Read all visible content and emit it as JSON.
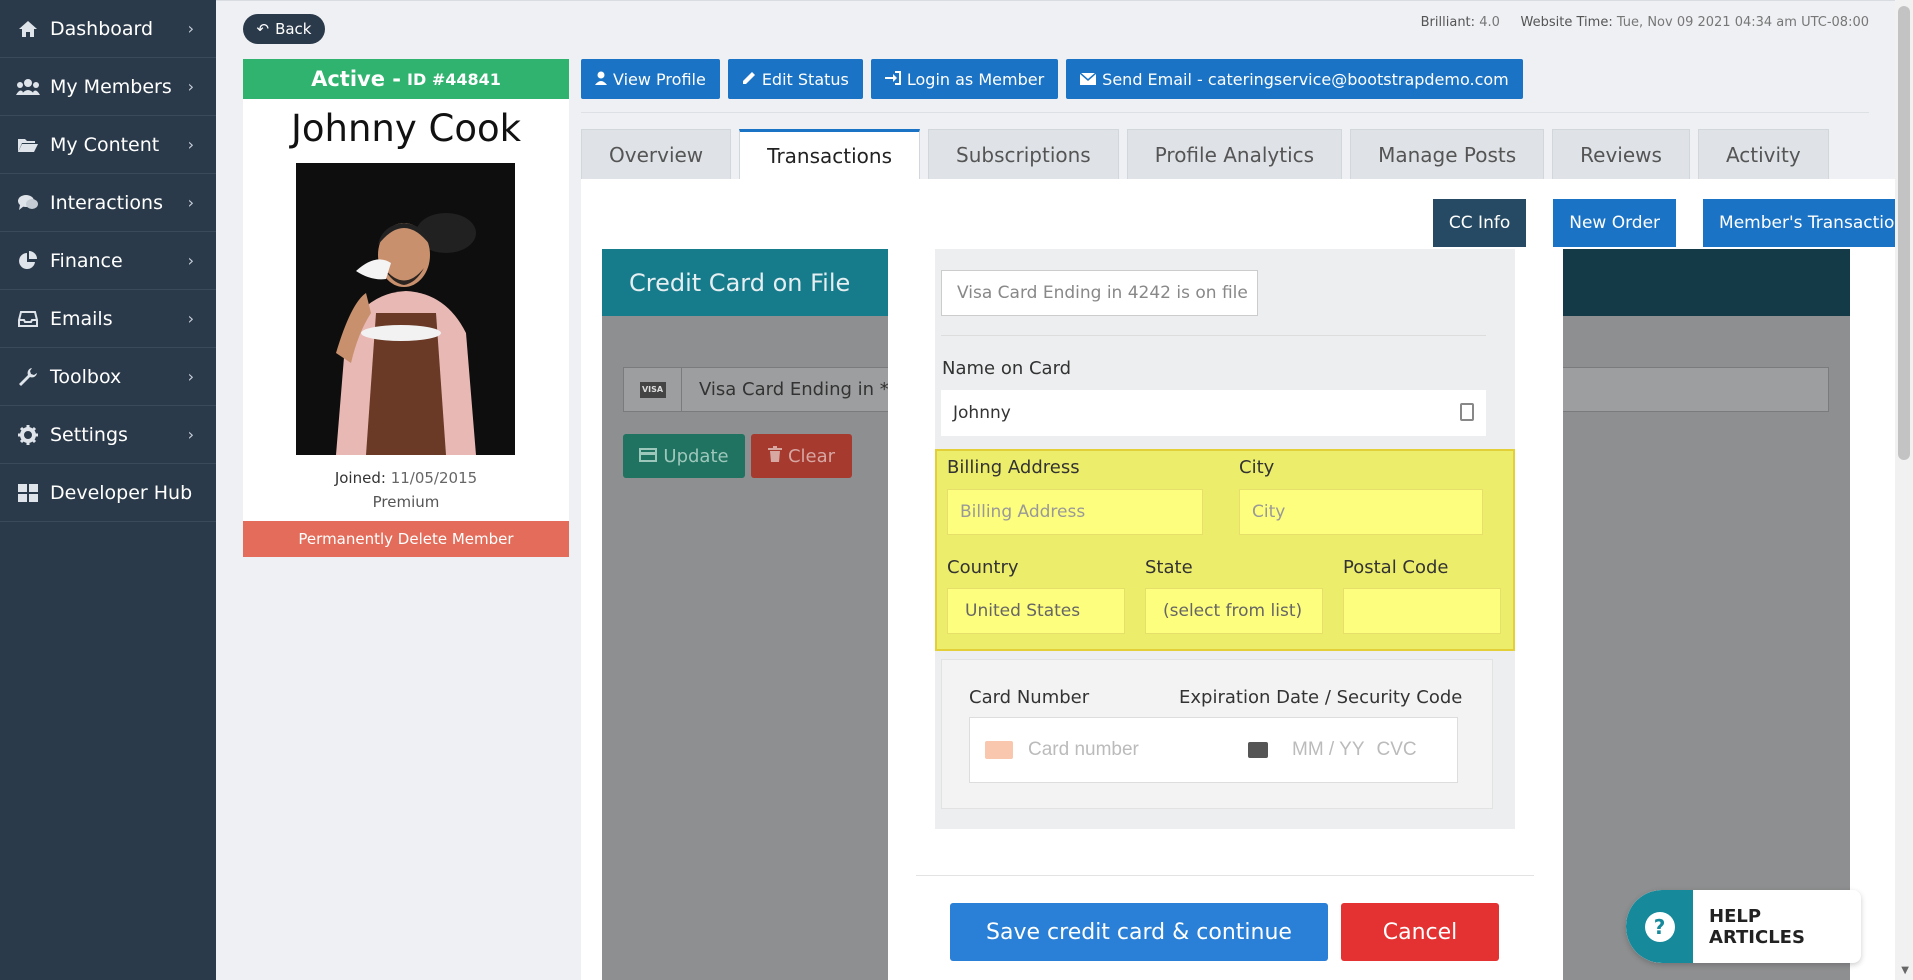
{
  "sidebar": {
    "items": [
      {
        "label": "Dashboard",
        "icon": "home-icon"
      },
      {
        "label": "My Members",
        "icon": "users-icon"
      },
      {
        "label": "My Content",
        "icon": "folder-icon"
      },
      {
        "label": "Interactions",
        "icon": "comments-icon"
      },
      {
        "label": "Finance",
        "icon": "pie-chart-icon"
      },
      {
        "label": "Emails",
        "icon": "inbox-icon"
      },
      {
        "label": "Toolbox",
        "icon": "wrench-icon"
      },
      {
        "label": "Settings",
        "icon": "gear-icon"
      },
      {
        "label": "Developer Hub",
        "icon": "grid-icon"
      }
    ]
  },
  "header": {
    "back_label": "Back",
    "brand_label": "Brilliant:",
    "brand_version": "4.0",
    "time_label": "Website Time:",
    "time_value": "Tue, Nov 09 2021 04:34 am UTC-08:00"
  },
  "profile": {
    "status": "Active -",
    "id": "ID #44841",
    "name": "Johnny Cook",
    "joined_label": "Joined:",
    "joined_date": "11/05/2015",
    "plan": "Premium",
    "delete_label": "Permanently Delete Member"
  },
  "actions": {
    "view_profile": "View Profile",
    "edit_status": "Edit Status",
    "login_as_member": "Login as Member",
    "send_email": "Send Email - cateringservice@bootstrapdemo.com"
  },
  "tabs": [
    "Overview",
    "Transactions",
    "Subscriptions",
    "Profile Analytics",
    "Manage Posts",
    "Reviews",
    "Activity"
  ],
  "active_tab": "Transactions",
  "sub_buttons": {
    "cc_info": "CC Info",
    "new_order": "New Order",
    "members_transactions": "Member's Transactions"
  },
  "cc_card": {
    "title": "Credit Card on File",
    "visa_badge": "VISA",
    "field_text": "Visa Card Ending in ***",
    "update_label": "Update",
    "clear_label": "Clear"
  },
  "modal": {
    "card_on_file": "Visa Card Ending in 4242 is on file",
    "name_label": "Name on Card",
    "name_value": "Johnny",
    "billing_address_label": "Billing Address",
    "billing_address_placeholder": "Billing Address",
    "city_label": "City",
    "city_placeholder": "City",
    "country_label": "Country",
    "country_value": "United States",
    "state_label": "State",
    "state_value": "(select from list)",
    "postal_label": "Postal Code",
    "postal_value": "",
    "card_number_label": "Card Number",
    "expiry_label": "Expiration Date / Security Code",
    "card_number_placeholder": "Card number",
    "expiry_placeholder": "MM / YY",
    "cvc_placeholder": "CVC",
    "save_label": "Save credit card & continue",
    "cancel_label": "Cancel"
  },
  "help": {
    "label": "HELP ARTICLES"
  },
  "colors": {
    "sidebar_bg": "#2b3a4a",
    "primary": "#1a73c5",
    "active_green": "#2fb36f",
    "delete_red": "#e36d5a",
    "highlight_yellow": "#eded6c",
    "save_blue": "#2a7fd6",
    "cancel_red": "#e43232",
    "cc_info_dark": "#264a63",
    "help_teal": "#16899b"
  }
}
